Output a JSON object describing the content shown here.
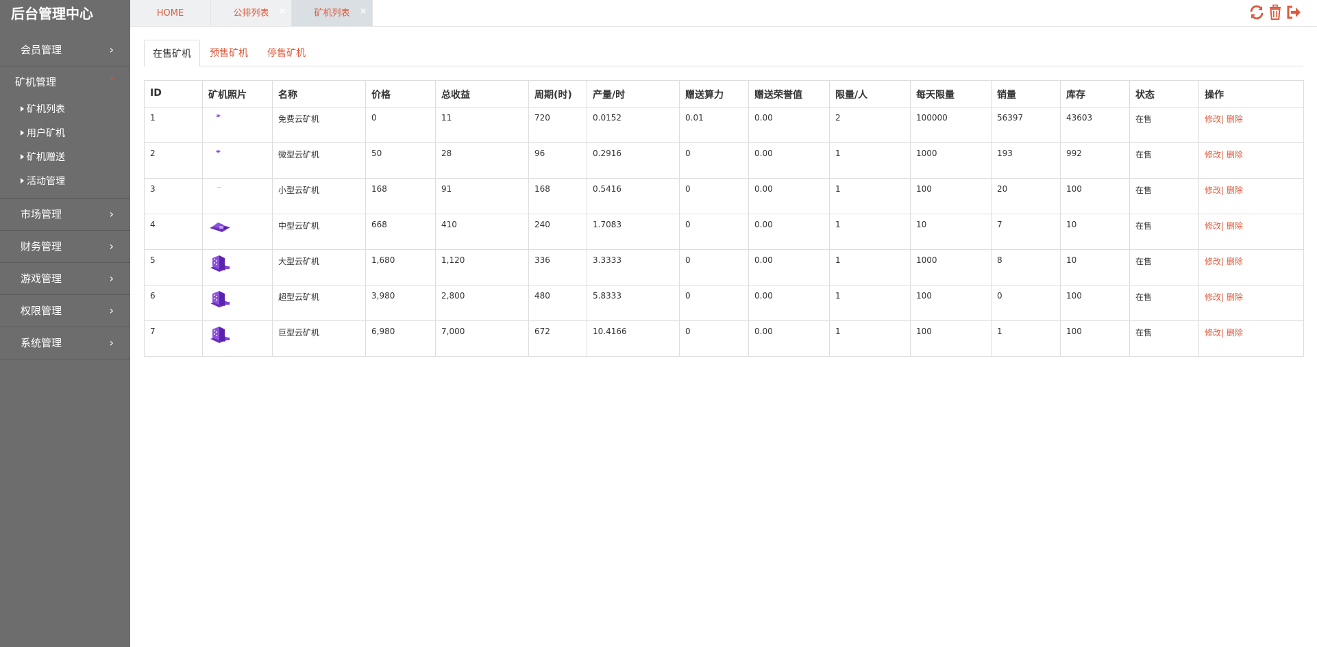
{
  "app": {
    "title": "后台管理中心"
  },
  "sidebar": {
    "groups": [
      {
        "label": "会员管理"
      },
      {
        "label": "矿机管理",
        "items": [
          "矿机列表",
          "用户矿机",
          "矿机赠送",
          "活动管理"
        ]
      },
      {
        "label": "市场管理"
      },
      {
        "label": "财务管理"
      },
      {
        "label": "游戏管理"
      },
      {
        "label": "权限管理"
      },
      {
        "label": "系统管理"
      }
    ]
  },
  "topbar": {
    "tabs": [
      "HOME",
      "公排列表",
      "矿机列表"
    ],
    "close_glyph": "×",
    "icons": [
      "refresh-icon",
      "trash-icon",
      "logout-icon"
    ]
  },
  "subtabs": [
    "在售矿机",
    "预售矿机",
    "停售矿机"
  ],
  "table": {
    "columns": [
      "ID",
      "矿机照片",
      "名称",
      "价格",
      "总收益",
      "周期(时)",
      "产量/时",
      "赠送算力",
      "赠送荣誉值",
      "限量/人",
      "每天限量",
      "销量",
      "库存",
      "状态",
      "操作"
    ],
    "rows": [
      {
        "id": "1",
        "image": "tiny",
        "name": "免费云矿机",
        "price": "0",
        "total": "11",
        "cycle": "720",
        "rate": "0.0152",
        "power": "0.01",
        "honor": "0.00",
        "limit": "2",
        "daily": "100000",
        "sold": "56397",
        "stock": "43603",
        "status": "在售",
        "edit": "修改",
        "sep": "|",
        "del": "删除"
      },
      {
        "id": "2",
        "image": "tiny",
        "name": "微型云矿机",
        "price": "50",
        "total": "28",
        "cycle": "96",
        "rate": "0.2916",
        "power": "0",
        "honor": "0.00",
        "limit": "1",
        "daily": "1000",
        "sold": "193",
        "stock": "992",
        "status": "在售",
        "edit": "修改",
        "sep": "|",
        "del": "删除"
      },
      {
        "id": "3",
        "image": "dot",
        "name": "小型云矿机",
        "price": "168",
        "total": "91",
        "cycle": "168",
        "rate": "0.5416",
        "power": "0",
        "honor": "0.00",
        "limit": "1",
        "daily": "100",
        "sold": "20",
        "stock": "100",
        "status": "在售",
        "edit": "修改",
        "sep": "|",
        "del": "删除"
      },
      {
        "id": "4",
        "image": "medium",
        "name": "中型云矿机",
        "price": "668",
        "total": "410",
        "cycle": "240",
        "rate": "1.7083",
        "power": "0",
        "honor": "0.00",
        "limit": "1",
        "daily": "10",
        "sold": "7",
        "stock": "10",
        "status": "在售",
        "edit": "修改",
        "sep": "|",
        "del": "删除"
      },
      {
        "id": "5",
        "image": "large",
        "name": "大型云矿机",
        "price": "1,680",
        "total": "1,120",
        "cycle": "336",
        "rate": "3.3333",
        "power": "0",
        "honor": "0.00",
        "limit": "1",
        "daily": "1000",
        "sold": "8",
        "stock": "10",
        "status": "在售",
        "edit": "修改",
        "sep": "|",
        "del": "删除"
      },
      {
        "id": "6",
        "image": "large",
        "name": "超型云矿机",
        "price": "3,980",
        "total": "2,800",
        "cycle": "480",
        "rate": "5.8333",
        "power": "0",
        "honor": "0.00",
        "limit": "1",
        "daily": "100",
        "sold": "0",
        "stock": "100",
        "status": "在售",
        "edit": "修改",
        "sep": "|",
        "del": "删除"
      },
      {
        "id": "7",
        "image": "large",
        "name": "巨型云矿机",
        "price": "6,980",
        "total": "7,000",
        "cycle": "672",
        "rate": "10.4166",
        "power": "0",
        "honor": "0.00",
        "limit": "1",
        "daily": "100",
        "sold": "1",
        "stock": "100",
        "status": "在售",
        "edit": "修改",
        "sep": "|",
        "del": "删除"
      }
    ]
  },
  "colors": {
    "accent": "#e0593a",
    "sidebar": "#6d6d6d",
    "purple": "#7b3fc9"
  }
}
